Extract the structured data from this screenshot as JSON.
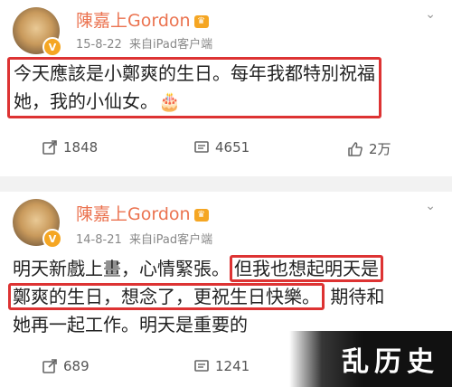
{
  "posts": [
    {
      "username": "陳嘉上Gordon",
      "date": "15-8-22",
      "source": "来自iPad客户端",
      "text_line1": "今天應該是小鄭爽的生日。每年我都特別祝福",
      "text_line2": "她，我的小仙女。",
      "emoji": "🎂",
      "repost_count": "1848",
      "comment_count": "4651",
      "like_count": "2万"
    },
    {
      "username": "陳嘉上Gordon",
      "date": "14-8-21",
      "source": "来自iPad客户端",
      "line1_plain": "明天新戲上畫，心情緊張。",
      "line1_hl": "但我也想起明天是",
      "line2_hl": "鄭爽的生日，想念了，更祝生日快樂。",
      "line2_plain": "期待和",
      "line3": "她再一起工作。明天是重要的",
      "repost_count": "689",
      "comment_count": "1241"
    }
  ],
  "watermark": "乱历史",
  "colors": {
    "username": "#eb7350",
    "highlight": "#dd3333",
    "meta": "#888888"
  }
}
